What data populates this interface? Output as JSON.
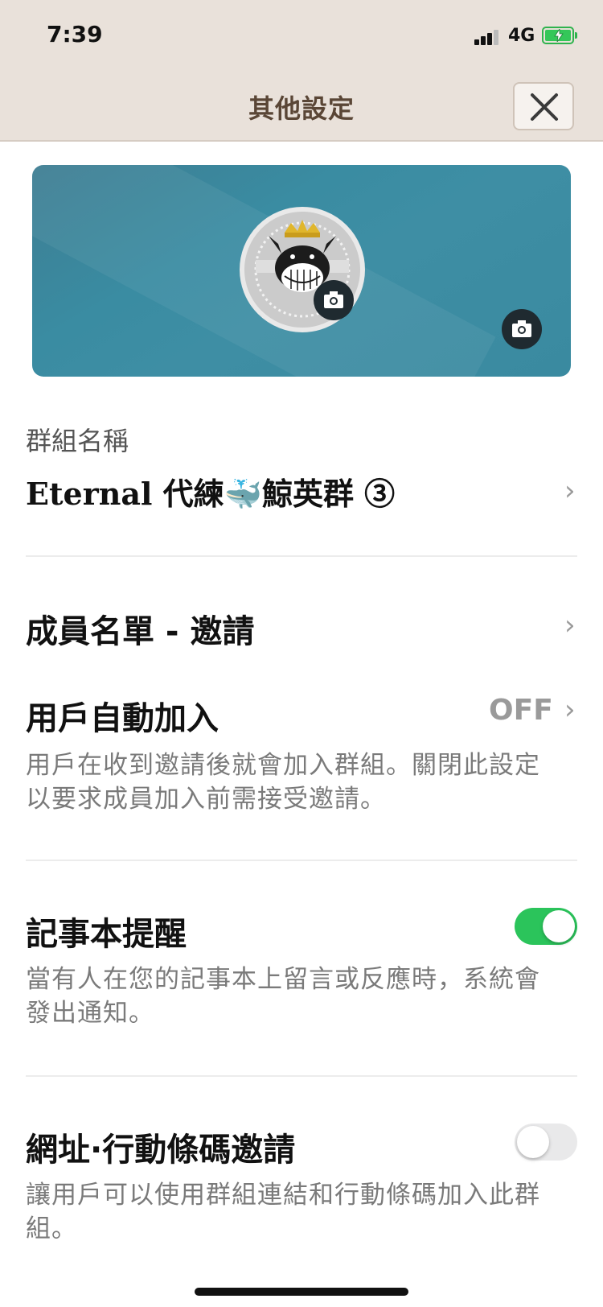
{
  "status_bar": {
    "time": "7:39",
    "network": "4G"
  },
  "header": {
    "title": "其他設定"
  },
  "group_name": {
    "label": "群組名稱",
    "value": "Eternal 代練🐳鯨英群 ③"
  },
  "members": {
    "title": "成員名單 - 邀請"
  },
  "auto_join": {
    "title": "用戶自動加入",
    "value": "OFF",
    "description": "用戶在收到邀請後就會加入群組。關閉此設定以要求成員加入前需接受邀請。"
  },
  "notes_reminder": {
    "title": "記事本提醒",
    "enabled": true,
    "description": "當有人在您的記事本上留言或反應時，系統會發出通知。"
  },
  "url_invite": {
    "title": "網址·行動條碼邀請",
    "enabled": false,
    "description": "讓用戶可以使用群組連結和行動條碼加入此群組。"
  },
  "colors": {
    "header_bg": "#e9e1da",
    "title_brown": "#5a4636",
    "cover_teal": "#3a8ca2",
    "toggle_on": "#2bc45b"
  },
  "icons": [
    "close-icon",
    "camera-icon",
    "chevron-right-icon",
    "signal-icon",
    "battery-icon"
  ]
}
